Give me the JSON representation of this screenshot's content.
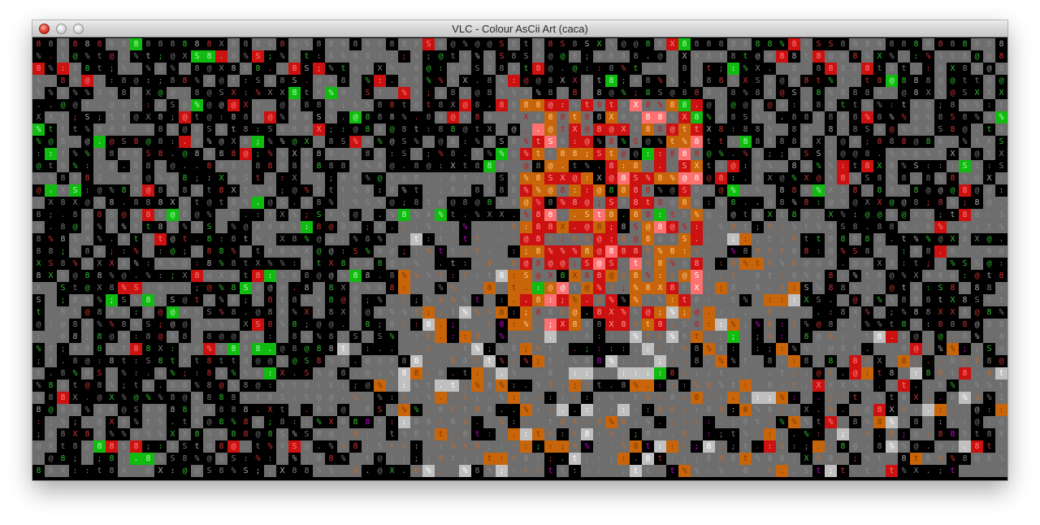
{
  "window": {
    "title": "VLC - Colour AsCii Art (caca)"
  },
  "video": {
    "renderer": "Colour AsCii Art (caca)",
    "columns": 80,
    "rows": 36,
    "background": "#000000",
    "palette": {
      "gray": "#6e6e6e",
      "light_gray": "#c0c0c0",
      "red": "#cc1111",
      "green": "#11bb11",
      "orange": "#c8640a",
      "pink": "#ff7070",
      "magenta": "#cc00cc",
      "blue": "#2222cc"
    },
    "glyphs": [
      "8",
      "8",
      "8",
      "8",
      "@",
      "@",
      "X",
      "S",
      "%",
      "t",
      ";",
      ":",
      ".",
      "%"
    ],
    "first_row_text": "8 8 8 8 8 8 8 8 8 8 8 8 8 8 8 X 8 8 8 S 8 @ S 8 8 8 8 8 S 8 8 X S @ @ % @ @ S 8 t @ 8 S 8 S X % @ @ 8 8 X 8 8 8 8 8 8 8 8 % 8 X S S"
  }
}
